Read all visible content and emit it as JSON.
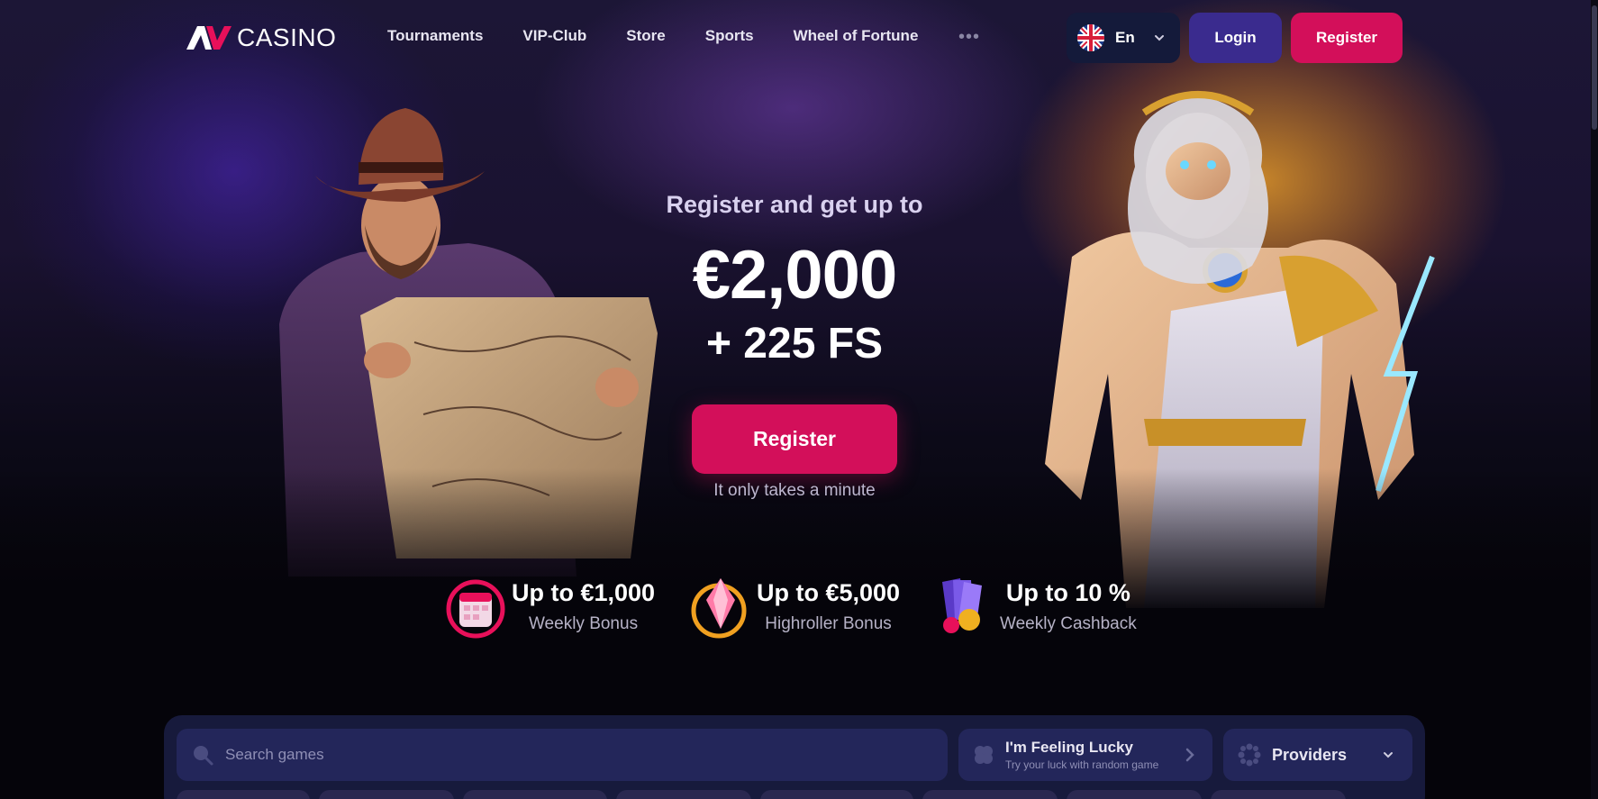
{
  "header": {
    "logo_text": "CASINO",
    "nav": [
      "Tournaments",
      "VIP-Club",
      "Store",
      "Sports",
      "Wheel of Fortune"
    ],
    "more_icon": "more-dots-icon",
    "language": {
      "label": "En",
      "flag_icon": "uk-flag-icon"
    },
    "login_label": "Login",
    "register_label": "Register"
  },
  "promo": {
    "subtitle": "Register and get up to",
    "amount": "€2,000",
    "free_spins": "+ 225 FS",
    "cta_label": "Register",
    "note": "It only takes a minute"
  },
  "bonuses": [
    {
      "title": "Up to €1,000",
      "subtitle": "Weekly Bonus",
      "icon": "calendar-bonus-icon"
    },
    {
      "title": "Up to €5,000",
      "subtitle": "Highroller Bonus",
      "icon": "crystal-bonus-icon"
    },
    {
      "title": "Up to 10 %",
      "subtitle": "Weekly Cashback",
      "icon": "cashback-cards-icon"
    }
  ],
  "games_panel": {
    "search_placeholder": "Search games",
    "lucky_title": "I'm Feeling Lucky",
    "lucky_subtitle": "Try your luck with random game",
    "providers_label": "Providers"
  },
  "colors": {
    "accent": "#d30f5a",
    "login_bg": "#3a2b8e",
    "panel_bg": "#171a3c",
    "field_bg": "#23265a"
  }
}
